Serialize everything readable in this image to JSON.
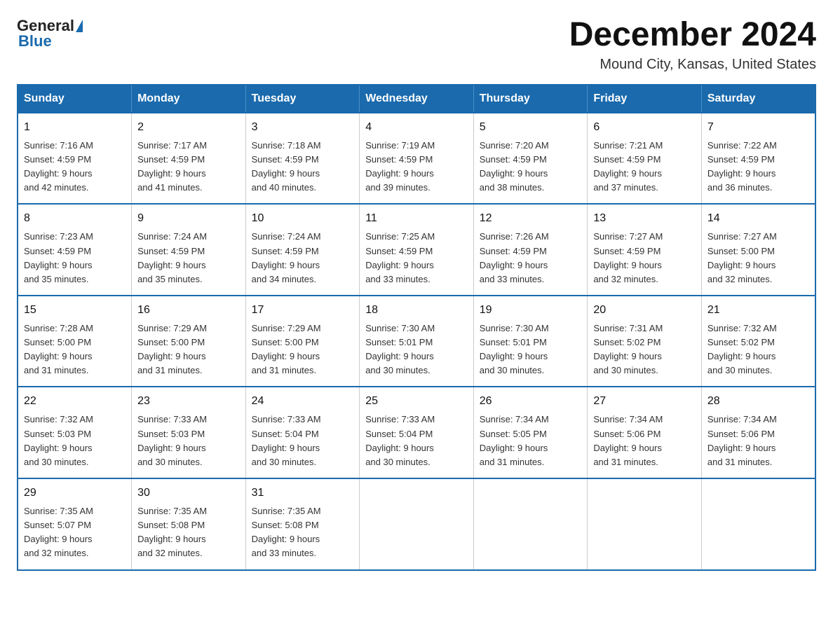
{
  "header": {
    "logo_general": "General",
    "logo_blue": "Blue",
    "title": "December 2024",
    "subtitle": "Mound City, Kansas, United States"
  },
  "calendar": {
    "days_of_week": [
      "Sunday",
      "Monday",
      "Tuesday",
      "Wednesday",
      "Thursday",
      "Friday",
      "Saturday"
    ],
    "weeks": [
      [
        {
          "day": "1",
          "sunrise": "7:16 AM",
          "sunset": "4:59 PM",
          "daylight": "9 hours and 42 minutes."
        },
        {
          "day": "2",
          "sunrise": "7:17 AM",
          "sunset": "4:59 PM",
          "daylight": "9 hours and 41 minutes."
        },
        {
          "day": "3",
          "sunrise": "7:18 AM",
          "sunset": "4:59 PM",
          "daylight": "9 hours and 40 minutes."
        },
        {
          "day": "4",
          "sunrise": "7:19 AM",
          "sunset": "4:59 PM",
          "daylight": "9 hours and 39 minutes."
        },
        {
          "day": "5",
          "sunrise": "7:20 AM",
          "sunset": "4:59 PM",
          "daylight": "9 hours and 38 minutes."
        },
        {
          "day": "6",
          "sunrise": "7:21 AM",
          "sunset": "4:59 PM",
          "daylight": "9 hours and 37 minutes."
        },
        {
          "day": "7",
          "sunrise": "7:22 AM",
          "sunset": "4:59 PM",
          "daylight": "9 hours and 36 minutes."
        }
      ],
      [
        {
          "day": "8",
          "sunrise": "7:23 AM",
          "sunset": "4:59 PM",
          "daylight": "9 hours and 35 minutes."
        },
        {
          "day": "9",
          "sunrise": "7:24 AM",
          "sunset": "4:59 PM",
          "daylight": "9 hours and 35 minutes."
        },
        {
          "day": "10",
          "sunrise": "7:24 AM",
          "sunset": "4:59 PM",
          "daylight": "9 hours and 34 minutes."
        },
        {
          "day": "11",
          "sunrise": "7:25 AM",
          "sunset": "4:59 PM",
          "daylight": "9 hours and 33 minutes."
        },
        {
          "day": "12",
          "sunrise": "7:26 AM",
          "sunset": "4:59 PM",
          "daylight": "9 hours and 33 minutes."
        },
        {
          "day": "13",
          "sunrise": "7:27 AM",
          "sunset": "4:59 PM",
          "daylight": "9 hours and 32 minutes."
        },
        {
          "day": "14",
          "sunrise": "7:27 AM",
          "sunset": "5:00 PM",
          "daylight": "9 hours and 32 minutes."
        }
      ],
      [
        {
          "day": "15",
          "sunrise": "7:28 AM",
          "sunset": "5:00 PM",
          "daylight": "9 hours and 31 minutes."
        },
        {
          "day": "16",
          "sunrise": "7:29 AM",
          "sunset": "5:00 PM",
          "daylight": "9 hours and 31 minutes."
        },
        {
          "day": "17",
          "sunrise": "7:29 AM",
          "sunset": "5:00 PM",
          "daylight": "9 hours and 31 minutes."
        },
        {
          "day": "18",
          "sunrise": "7:30 AM",
          "sunset": "5:01 PM",
          "daylight": "9 hours and 30 minutes."
        },
        {
          "day": "19",
          "sunrise": "7:30 AM",
          "sunset": "5:01 PM",
          "daylight": "9 hours and 30 minutes."
        },
        {
          "day": "20",
          "sunrise": "7:31 AM",
          "sunset": "5:02 PM",
          "daylight": "9 hours and 30 minutes."
        },
        {
          "day": "21",
          "sunrise": "7:32 AM",
          "sunset": "5:02 PM",
          "daylight": "9 hours and 30 minutes."
        }
      ],
      [
        {
          "day": "22",
          "sunrise": "7:32 AM",
          "sunset": "5:03 PM",
          "daylight": "9 hours and 30 minutes."
        },
        {
          "day": "23",
          "sunrise": "7:33 AM",
          "sunset": "5:03 PM",
          "daylight": "9 hours and 30 minutes."
        },
        {
          "day": "24",
          "sunrise": "7:33 AM",
          "sunset": "5:04 PM",
          "daylight": "9 hours and 30 minutes."
        },
        {
          "day": "25",
          "sunrise": "7:33 AM",
          "sunset": "5:04 PM",
          "daylight": "9 hours and 30 minutes."
        },
        {
          "day": "26",
          "sunrise": "7:34 AM",
          "sunset": "5:05 PM",
          "daylight": "9 hours and 31 minutes."
        },
        {
          "day": "27",
          "sunrise": "7:34 AM",
          "sunset": "5:06 PM",
          "daylight": "9 hours and 31 minutes."
        },
        {
          "day": "28",
          "sunrise": "7:34 AM",
          "sunset": "5:06 PM",
          "daylight": "9 hours and 31 minutes."
        }
      ],
      [
        {
          "day": "29",
          "sunrise": "7:35 AM",
          "sunset": "5:07 PM",
          "daylight": "9 hours and 32 minutes."
        },
        {
          "day": "30",
          "sunrise": "7:35 AM",
          "sunset": "5:08 PM",
          "daylight": "9 hours and 32 minutes."
        },
        {
          "day": "31",
          "sunrise": "7:35 AM",
          "sunset": "5:08 PM",
          "daylight": "9 hours and 33 minutes."
        },
        null,
        null,
        null,
        null
      ]
    ],
    "labels": {
      "sunrise": "Sunrise:",
      "sunset": "Sunset:",
      "daylight": "Daylight:"
    }
  }
}
